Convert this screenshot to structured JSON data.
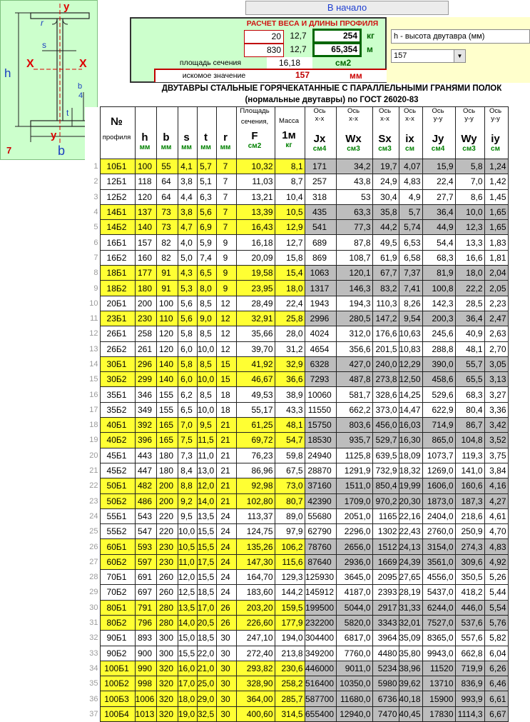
{
  "nav": {
    "home_label": "В начало"
  },
  "diagram": {
    "y_top": "y",
    "y_bottom": "y",
    "x_left": "X",
    "x_right": "X",
    "h": "h",
    "b": "b",
    "s": "s",
    "t": "t",
    "r": "r",
    "b4_top": "b",
    "b4_bottom": "4",
    "corner_num": "7"
  },
  "calc": {
    "title": "РАСЧЕТ ВЕСА И ДЛИНЫ ПРОФИЛЯ",
    "row1": {
      "input": "20",
      "factor": "12,7",
      "result": "254",
      "unit": "кг"
    },
    "row2": {
      "input": "830",
      "factor": "12,7",
      "result": "65,354",
      "unit": "м"
    },
    "area_label": "площадь сечения",
    "area_value": "16,18",
    "area_unit": "см2",
    "sought_label": "искомое значение",
    "sought_value": "157",
    "sought_unit": "мм"
  },
  "selectors": {
    "param_value": "h - высота  двутавра (мм)",
    "profile_value": "157"
  },
  "table": {
    "title1": "ДВУТАВРЫ СТАЛЬНЫЕ ГОРЯЧЕКАТАННЫЕ С ПАРАЛЛЕЛЬНЫМИ ГРАНЯМИ ПОЛОК",
    "title2": "(нормальные двутавры) по ГОСТ 26020-83",
    "headers": {
      "no_sym": "№",
      "no_txt": "профиля",
      "h": "h",
      "b": "b",
      "s": "s",
      "t": "t",
      "r": "r",
      "mm": "мм",
      "f_top": "Площадь",
      "f_mid": "сечения,",
      "f_sym": "F",
      "f_unit": "см2",
      "m_top": "Масса",
      "m_sym": "1м",
      "m_unit": "кг",
      "ax_top": "Ось",
      "axx": "x-x",
      "ayy": "y-y",
      "jx": "Jx",
      "wx": "Wx",
      "sx": "Sx",
      "ix": "ix",
      "jy": "Jy",
      "wy": "Wy",
      "iy": "iy",
      "u_cm4": "см4",
      "u_cm3": "см3",
      "u_cm": "см"
    },
    "rows": [
      {
        "n": "1",
        "name": "10Б1",
        "h": "100",
        "b": "55",
        "s": "4,1",
        "t": "5,7",
        "r": "7",
        "F": "10,32",
        "m": "8,1",
        "Jx": "171",
        "Wx": "34,2",
        "Sx": "19,7",
        "ix": "4,07",
        "Jy": "15,9",
        "Wy": "5,8",
        "iy": "1,24",
        "hl": true
      },
      {
        "n": "2",
        "name": "12Б1",
        "h": "118",
        "b": "64",
        "s": "3,8",
        "t": "5,1",
        "r": "7",
        "F": "11,03",
        "m": "8,7",
        "Jx": "257",
        "Wx": "43,8",
        "Sx": "24,9",
        "ix": "4,83",
        "Jy": "22,4",
        "Wy": "7,0",
        "iy": "1,42",
        "hl": false
      },
      {
        "n": "3",
        "name": "12Б2",
        "h": "120",
        "b": "64",
        "s": "4,4",
        "t": "6,3",
        "r": "7",
        "F": "13,21",
        "m": "10,4",
        "Jx": "318",
        "Wx": "53",
        "Sx": "30,4",
        "ix": "4,9",
        "Jy": "27,7",
        "Wy": "8,6",
        "iy": "1,45",
        "hl": false
      },
      {
        "n": "4",
        "name": "14Б1",
        "h": "137",
        "b": "73",
        "s": "3,8",
        "t": "5,6",
        "r": "7",
        "F": "13,39",
        "m": "10,5",
        "Jx": "435",
        "Wx": "63,3",
        "Sx": "35,8",
        "ix": "5,7",
        "Jy": "36,4",
        "Wy": "10,0",
        "iy": "1,65",
        "hl": true
      },
      {
        "n": "5",
        "name": "14Б2",
        "h": "140",
        "b": "73",
        "s": "4,7",
        "t": "6,9",
        "r": "7",
        "F": "16,43",
        "m": "12,9",
        "Jx": "541",
        "Wx": "77,3",
        "Sx": "44,2",
        "ix": "5,74",
        "Jy": "44,9",
        "Wy": "12,3",
        "iy": "1,65",
        "hl": true
      },
      {
        "n": "6",
        "name": "16Б1",
        "h": "157",
        "b": "82",
        "s": "4,0",
        "t": "5,9",
        "r": "9",
        "F": "16,18",
        "m": "12,7",
        "Jx": "689",
        "Wx": "87,8",
        "Sx": "49,5",
        "ix": "6,53",
        "Jy": "54,4",
        "Wy": "13,3",
        "iy": "1,83",
        "hl": false
      },
      {
        "n": "7",
        "name": "16Б2",
        "h": "160",
        "b": "82",
        "s": "5,0",
        "t": "7,4",
        "r": "9",
        "F": "20,09",
        "m": "15,8",
        "Jx": "869",
        "Wx": "108,7",
        "Sx": "61,9",
        "ix": "6,58",
        "Jy": "68,3",
        "Wy": "16,6",
        "iy": "1,81",
        "hl": false
      },
      {
        "n": "8",
        "name": "18Б1",
        "h": "177",
        "b": "91",
        "s": "4,3",
        "t": "6,5",
        "r": "9",
        "F": "19,58",
        "m": "15,4",
        "Jx": "1063",
        "Wx": "120,1",
        "Sx": "67,7",
        "ix": "7,37",
        "Jy": "81,9",
        "Wy": "18,0",
        "iy": "2,04",
        "hl": true
      },
      {
        "n": "9",
        "name": "18Б2",
        "h": "180",
        "b": "91",
        "s": "5,3",
        "t": "8,0",
        "r": "9",
        "F": "23,95",
        "m": "18,0",
        "Jx": "1317",
        "Wx": "146,3",
        "Sx": "83,2",
        "ix": "7,41",
        "Jy": "100,8",
        "Wy": "22,2",
        "iy": "2,05",
        "hl": true
      },
      {
        "n": "10",
        "name": "20Б1",
        "h": "200",
        "b": "100",
        "s": "5,6",
        "t": "8,5",
        "r": "12",
        "F": "28,49",
        "m": "22,4",
        "Jx": "1943",
        "Wx": "194,3",
        "Sx": "110,3",
        "ix": "8,26",
        "Jy": "142,3",
        "Wy": "28,5",
        "iy": "2,23",
        "hl": false
      },
      {
        "n": "11",
        "name": "23Б1",
        "h": "230",
        "b": "110",
        "s": "5,6",
        "t": "9,0",
        "r": "12",
        "F": "32,91",
        "m": "25,8",
        "Jx": "2996",
        "Wx": "280,5",
        "Sx": "147,2",
        "ix": "9,54",
        "Jy": "200,3",
        "Wy": "36,4",
        "iy": "2,47",
        "hl": true
      },
      {
        "n": "12",
        "name": "26Б1",
        "h": "258",
        "b": "120",
        "s": "5,8",
        "t": "8,5",
        "r": "12",
        "F": "35,66",
        "m": "28,0",
        "Jx": "4024",
        "Wx": "312,0",
        "Sx": "176,6",
        "ix": "10,63",
        "Jy": "245,6",
        "Wy": "40,9",
        "iy": "2,63",
        "hl": false
      },
      {
        "n": "13",
        "name": "26Б2",
        "h": "261",
        "b": "120",
        "s": "6,0",
        "t": "10,0",
        "r": "12",
        "F": "39,70",
        "m": "31,2",
        "Jx": "4654",
        "Wx": "356,6",
        "Sx": "201,5",
        "ix": "10,83",
        "Jy": "288,8",
        "Wy": "48,1",
        "iy": "2,70",
        "hl": false
      },
      {
        "n": "14",
        "name": "30Б1",
        "h": "296",
        "b": "140",
        "s": "5,8",
        "t": "8,5",
        "r": "15",
        "F": "41,92",
        "m": "32,9",
        "Jx": "6328",
        "Wx": "427,0",
        "Sx": "240,0",
        "ix": "12,29",
        "Jy": "390,0",
        "Wy": "55,7",
        "iy": "3,05",
        "hl": true
      },
      {
        "n": "15",
        "name": "30Б2",
        "h": "299",
        "b": "140",
        "s": "6,0",
        "t": "10,0",
        "r": "15",
        "F": "46,67",
        "m": "36,6",
        "Jx": "7293",
        "Wx": "487,8",
        "Sx": "273,8",
        "ix": "12,50",
        "Jy": "458,6",
        "Wy": "65,5",
        "iy": "3,13",
        "hl": true
      },
      {
        "n": "16",
        "name": "35Б1",
        "h": "346",
        "b": "155",
        "s": "6,2",
        "t": "8,5",
        "r": "18",
        "F": "49,53",
        "m": "38,9",
        "Jx": "10060",
        "Wx": "581,7",
        "Sx": "328,6",
        "ix": "14,25",
        "Jy": "529,6",
        "Wy": "68,3",
        "iy": "3,27",
        "hl": false
      },
      {
        "n": "17",
        "name": "35Б2",
        "h": "349",
        "b": "155",
        "s": "6,5",
        "t": "10,0",
        "r": "18",
        "F": "55,17",
        "m": "43,3",
        "Jx": "11550",
        "Wx": "662,2",
        "Sx": "373,0",
        "ix": "14,47",
        "Jy": "622,9",
        "Wy": "80,4",
        "iy": "3,36",
        "hl": false
      },
      {
        "n": "18",
        "name": "40Б1",
        "h": "392",
        "b": "165",
        "s": "7,0",
        "t": "9,5",
        "r": "21",
        "F": "61,25",
        "m": "48,1",
        "Jx": "15750",
        "Wx": "803,6",
        "Sx": "456,0",
        "ix": "16,03",
        "Jy": "714,9",
        "Wy": "86,7",
        "iy": "3,42",
        "hl": true
      },
      {
        "n": "19",
        "name": "40Б2",
        "h": "396",
        "b": "165",
        "s": "7,5",
        "t": "11,5",
        "r": "21",
        "F": "69,72",
        "m": "54,7",
        "Jx": "18530",
        "Wx": "935,7",
        "Sx": "529,7",
        "ix": "16,30",
        "Jy": "865,0",
        "Wy": "104,8",
        "iy": "3,52",
        "hl": true
      },
      {
        "n": "20",
        "name": "45Б1",
        "h": "443",
        "b": "180",
        "s": "7,3",
        "t": "11,0",
        "r": "21",
        "F": "76,23",
        "m": "59,8",
        "Jx": "24940",
        "Wx": "1125,8",
        "Sx": "639,5",
        "ix": "18,09",
        "Jy": "1073,7",
        "Wy": "119,3",
        "iy": "3,75",
        "hl": false
      },
      {
        "n": "21",
        "name": "45Б2",
        "h": "447",
        "b": "180",
        "s": "8,4",
        "t": "13,0",
        "r": "21",
        "F": "86,96",
        "m": "67,5",
        "Jx": "28870",
        "Wx": "1291,9",
        "Sx": "732,9",
        "ix": "18,32",
        "Jy": "1269,0",
        "Wy": "141,0",
        "iy": "3,84",
        "hl": false
      },
      {
        "n": "22",
        "name": "50Б1",
        "h": "482",
        "b": "200",
        "s": "8,8",
        "t": "12,0",
        "r": "21",
        "F": "92,98",
        "m": "73,0",
        "Jx": "37160",
        "Wx": "1511,0",
        "Sx": "850,4",
        "ix": "19,99",
        "Jy": "1606,0",
        "Wy": "160,6",
        "iy": "4,16",
        "hl": true
      },
      {
        "n": "23",
        "name": "50Б2",
        "h": "486",
        "b": "200",
        "s": "9,2",
        "t": "14,0",
        "r": "21",
        "F": "102,80",
        "m": "80,7",
        "Jx": "42390",
        "Wx": "1709,0",
        "Sx": "970,2",
        "ix": "20,30",
        "Jy": "1873,0",
        "Wy": "187,3",
        "iy": "4,27",
        "hl": true
      },
      {
        "n": "24",
        "name": "55Б1",
        "h": "543",
        "b": "220",
        "s": "9,5",
        "t": "13,5",
        "r": "24",
        "F": "113,37",
        "m": "89,0",
        "Jx": "55680",
        "Wx": "2051,0",
        "Sx": "1165",
        "ix": "22,16",
        "Jy": "2404,0",
        "Wy": "218,6",
        "iy": "4,61",
        "hl": false
      },
      {
        "n": "25",
        "name": "55Б2",
        "h": "547",
        "b": "220",
        "s": "10,0",
        "t": "15,5",
        "r": "24",
        "F": "124,75",
        "m": "97,9",
        "Jx": "62790",
        "Wx": "2296,0",
        "Sx": "1302",
        "ix": "22,43",
        "Jy": "2760,0",
        "Wy": "250,9",
        "iy": "4,70",
        "hl": false
      },
      {
        "n": "26",
        "name": "60Б1",
        "h": "593",
        "b": "230",
        "s": "10,5",
        "t": "15,5",
        "r": "24",
        "F": "135,26",
        "m": "106,2",
        "Jx": "78760",
        "Wx": "2656,0",
        "Sx": "1512",
        "ix": "24,13",
        "Jy": "3154,0",
        "Wy": "274,3",
        "iy": "4,83",
        "hl": true
      },
      {
        "n": "27",
        "name": "60Б2",
        "h": "597",
        "b": "230",
        "s": "11,0",
        "t": "17,5",
        "r": "24",
        "F": "147,30",
        "m": "115,6",
        "Jx": "87640",
        "Wx": "2936,0",
        "Sx": "1669",
        "ix": "24,39",
        "Jy": "3561,0",
        "Wy": "309,6",
        "iy": "4,92",
        "hl": true
      },
      {
        "n": "28",
        "name": "70Б1",
        "h": "691",
        "b": "260",
        "s": "12,0",
        "t": "15,5",
        "r": "24",
        "F": "164,70",
        "m": "129,3",
        "Jx": "125930",
        "Wx": "3645,0",
        "Sx": "2095",
        "ix": "27,65",
        "Jy": "4556,0",
        "Wy": "350,5",
        "iy": "5,26",
        "hl": false
      },
      {
        "n": "29",
        "name": "70Б2",
        "h": "697",
        "b": "260",
        "s": "12,5",
        "t": "18,5",
        "r": "24",
        "F": "183,60",
        "m": "144,2",
        "Jx": "145912",
        "Wx": "4187,0",
        "Sx": "2393",
        "ix": "28,19",
        "Jy": "5437,0",
        "Wy": "418,2",
        "iy": "5,44",
        "hl": false
      },
      {
        "n": "30",
        "name": "80Б1",
        "h": "791",
        "b": "280",
        "s": "13,5",
        "t": "17,0",
        "r": "26",
        "F": "203,20",
        "m": "159,5",
        "Jx": "199500",
        "Wx": "5044,0",
        "Sx": "2917",
        "ix": "31,33",
        "Jy": "6244,0",
        "Wy": "446,0",
        "iy": "5,54",
        "hl": true
      },
      {
        "n": "31",
        "name": "80Б2",
        "h": "796",
        "b": "280",
        "s": "14,0",
        "t": "20,5",
        "r": "26",
        "F": "226,60",
        "m": "177,9",
        "Jx": "232200",
        "Wx": "5820,0",
        "Sx": "3343",
        "ix": "32,01",
        "Jy": "7527,0",
        "Wy": "537,6",
        "iy": "5,76",
        "hl": true
      },
      {
        "n": "32",
        "name": "90Б1",
        "h": "893",
        "b": "300",
        "s": "15,0",
        "t": "18,5",
        "r": "30",
        "F": "247,10",
        "m": "194,0",
        "Jx": "304400",
        "Wx": "6817,0",
        "Sx": "3964",
        "ix": "35,09",
        "Jy": "8365,0",
        "Wy": "557,6",
        "iy": "5,82",
        "hl": false
      },
      {
        "n": "33",
        "name": "90Б2",
        "h": "900",
        "b": "300",
        "s": "15,5",
        "t": "22,0",
        "r": "30",
        "F": "272,40",
        "m": "213,8",
        "Jx": "349200",
        "Wx": "7760,0",
        "Sx": "4480",
        "ix": "35,80",
        "Jy": "9943,0",
        "Wy": "662,8",
        "iy": "6,04",
        "hl": false
      },
      {
        "n": "34",
        "name": "100Б1",
        "h": "990",
        "b": "320",
        "s": "16,0",
        "t": "21,0",
        "r": "30",
        "F": "293,82",
        "m": "230,6",
        "Jx": "446000",
        "Wx": "9011,0",
        "Sx": "5234",
        "ix": "38,96",
        "Jy": "11520",
        "Wy": "719,9",
        "iy": "6,26",
        "hl": true
      },
      {
        "n": "35",
        "name": "100Б2",
        "h": "998",
        "b": "320",
        "s": "17,0",
        "t": "25,0",
        "r": "30",
        "F": "328,90",
        "m": "258,2",
        "Jx": "516400",
        "Wx": "10350,0",
        "Sx": "5980",
        "ix": "39,62",
        "Jy": "13710",
        "Wy": "836,9",
        "iy": "6,46",
        "hl": true
      },
      {
        "n": "36",
        "name": "100Б3",
        "h": "1006",
        "b": "320",
        "s": "18,0",
        "t": "29,0",
        "r": "30",
        "F": "364,00",
        "m": "285,7",
        "Jx": "587700",
        "Wx": "11680,0",
        "Sx": "6736",
        "ix": "40,18",
        "Jy": "15900",
        "Wy": "993,9",
        "iy": "6,61",
        "hl": true
      },
      {
        "n": "37",
        "name": "100Б4",
        "h": "1013",
        "b": "320",
        "s": "19,0",
        "t": "32,5",
        "r": "30",
        "F": "400,60",
        "m": "314,5",
        "Jx": "655400",
        "Wx": "12940,0",
        "Sx": "7470",
        "ix": "40,45",
        "Jy": "17830",
        "Wy": "1114,3",
        "iy": "6,67",
        "hl": true
      }
    ]
  }
}
